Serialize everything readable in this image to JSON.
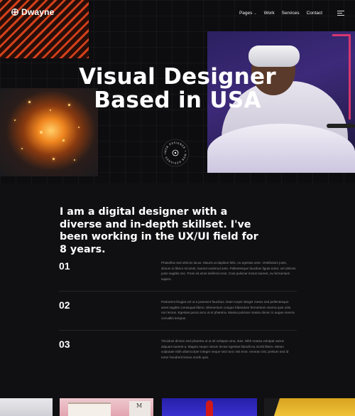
{
  "nav": {
    "logo_text": "Dwayne",
    "links": [
      {
        "label": "Pages",
        "has_caret": true
      },
      {
        "label": "Work"
      },
      {
        "label": "Services"
      },
      {
        "label": "Contact"
      }
    ]
  },
  "hero": {
    "title_line1": "Visual Designer",
    "title_line2": "Based in USA",
    "badge_text": "WEB DESIGNER • WEB DESIGNER •"
  },
  "about": {
    "intro": "I am a digital designer with a diverse and in-depth skillset. I've been working in the UX/UI field for 8 years.",
    "features": [
      {
        "number": "01",
        "text": "Phasellus sed ultrices lacus. Mauris at dapibus felis, eu egestas ante. Vestibulum justo, dictum ut libero sit amet, laoreet euismod ante. Pellentesque faucibus ligula tortor, vel ultrices justo sagittis nec. Proin sit amet eleifend eros. Cras pulvinar lectus laoreet, eu fermentum sapien."
      },
      {
        "number": "02",
        "text": "Parturient feugiat vel ut a praesent faucibus. Diam turpis integer metus sed pellentesque amet sagittis consequat libero. Elementum congue bibendum fermentum viverra quis odio non lectus. Egestas purus arcu ut et pharetra. Massa pulvinar massa donec in augue viverra convallis tempus."
      },
      {
        "number": "03",
        "text": "Tincidunt dictum sed pharetra ut ut sit volutpat urna, duis. Nibh massa volutpat varius aliquam laoreet a. Magna neque rutrum lectus egestas blandit eu morbi libero. Metus vulputate nibh ullamcorper integer neque sed nunc nisi eros. Aenean nisi, pretium sed id tortor hendrerit lectus morbi quis."
      }
    ]
  },
  "gallery": {
    "magazine_letter": "M"
  },
  "colors": {
    "background": "#101012",
    "accent_orange": "#e8461c",
    "muted_text": "#8d8d93"
  }
}
